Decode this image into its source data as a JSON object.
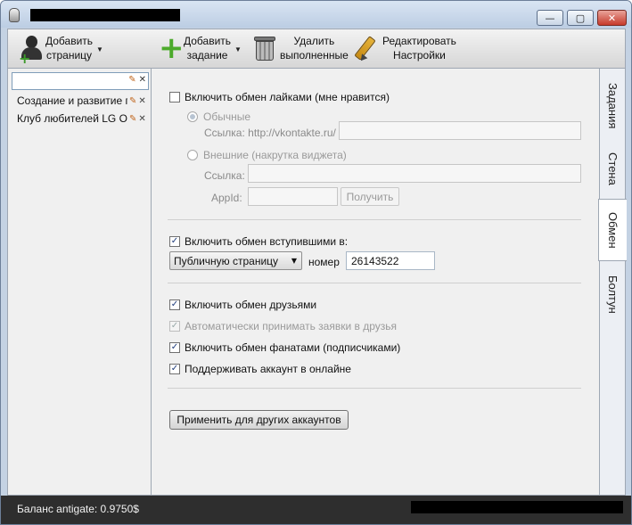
{
  "window": {
    "title": "",
    "controls": {
      "minimize": "—",
      "maximize": "▢",
      "close": "✕"
    }
  },
  "toolbar": {
    "add_page": {
      "line1": "Добавить",
      "line2": "страницу",
      "arrow": "▼"
    },
    "add_task": {
      "line1": "Добавить",
      "line2": "задание",
      "arrow": "▼"
    },
    "delete_done": {
      "line1": "Удалить",
      "line2": "выполненные"
    },
    "edit_settings": {
      "line1": "Редактировать",
      "line2": "Настройки"
    }
  },
  "sidebar": {
    "search": {
      "value": "",
      "edit_glyph": "✎",
      "clear_glyph": "✕"
    },
    "items": [
      {
        "name": "Создание и развитие г",
        "edit_glyph": "✎",
        "delete_glyph": "✕"
      },
      {
        "name": "Клуб любителей LG Op",
        "edit_glyph": "✎",
        "delete_glyph": "✕"
      }
    ]
  },
  "tabs": [
    {
      "label": "Задания",
      "active": false
    },
    {
      "label": "Стена",
      "active": false
    },
    {
      "label": "Обмен",
      "active": true
    },
    {
      "label": "Болтун",
      "active": false
    }
  ],
  "likes": {
    "enable_label": "Включить обмен лайками (мне нравится)",
    "enabled": false,
    "normal_label": "Обычные",
    "link_label": "Ссылка: http://vkontakte.ru/",
    "link_value": "",
    "external_label": "Внешние (накрутка виджета)",
    "external_link_label": "Ссылка:",
    "external_link_value": "",
    "appid_label": "AppId:",
    "appid_value": "",
    "get_button": "Получить"
  },
  "joined": {
    "enable_label": "Включить обмен вступившими в:",
    "enabled": true,
    "type_selected": "Публичную страницу",
    "number_label": "номер",
    "number_value": "26143522"
  },
  "friends": {
    "enable_friends": {
      "label": "Включить обмен друзьями",
      "checked": true
    },
    "auto_accept": {
      "label": "Автоматически принимать заявки в друзья",
      "checked": true,
      "disabled": true
    },
    "enable_fans": {
      "label": "Включить обмен фанатами (подписчиками)",
      "checked": true
    },
    "keep_online": {
      "label": "Поддерживать аккаунт в онлайне",
      "checked": true
    }
  },
  "apply_button": "Применить для других аккаунтов",
  "status": {
    "balance": "Баланс antigate: 0.9750$"
  },
  "glyphs": {
    "check": "✓",
    "dropdown": "▼"
  }
}
